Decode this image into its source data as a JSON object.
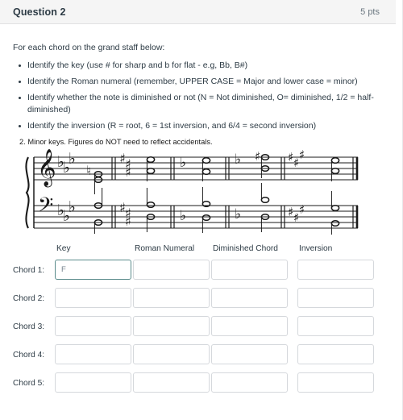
{
  "header": {
    "title": "Question 2",
    "points": "5 pts"
  },
  "instructions": {
    "lead": "For each chord on the grand staff below:",
    "bullets": [
      "Identify the key (use # for sharp and b for flat - e.g, Bb, B#)",
      "Identify the Roman numeral (remember, UPPER CASE = Major and lower case = minor)",
      "Identify whether the note is diminished or not (N = Not diminished, O= diminished, 1/2 = half-diminished)",
      "Identify the inversion (R = root, 6 = 1st inversion, and 6/4 = second inversion)"
    ]
  },
  "score": {
    "caption": "2. Minor keys. Figures do NOT need to reflect accidentals."
  },
  "answers": {
    "columns": [
      "Key",
      "Roman Numeral",
      "Diminished Chord",
      "Inversion"
    ],
    "rows": [
      {
        "label": "Chord 1:",
        "values": [
          "F",
          "",
          "",
          ""
        ]
      },
      {
        "label": "Chord 2:",
        "values": [
          "",
          "",
          "",
          ""
        ]
      },
      {
        "label": "Chord 3:",
        "values": [
          "",
          "",
          "",
          ""
        ]
      },
      {
        "label": "Chord 4:",
        "values": [
          "",
          "",
          "",
          ""
        ]
      },
      {
        "label": "Chord 5:",
        "values": [
          "",
          "",
          "",
          ""
        ]
      }
    ]
  },
  "colors": {
    "header_bg": "#f5f5f5",
    "text": "#2d3b45",
    "muted": "#6b7780",
    "field_border": "#d5d8dc",
    "focus_border": "#5b8c8c"
  }
}
